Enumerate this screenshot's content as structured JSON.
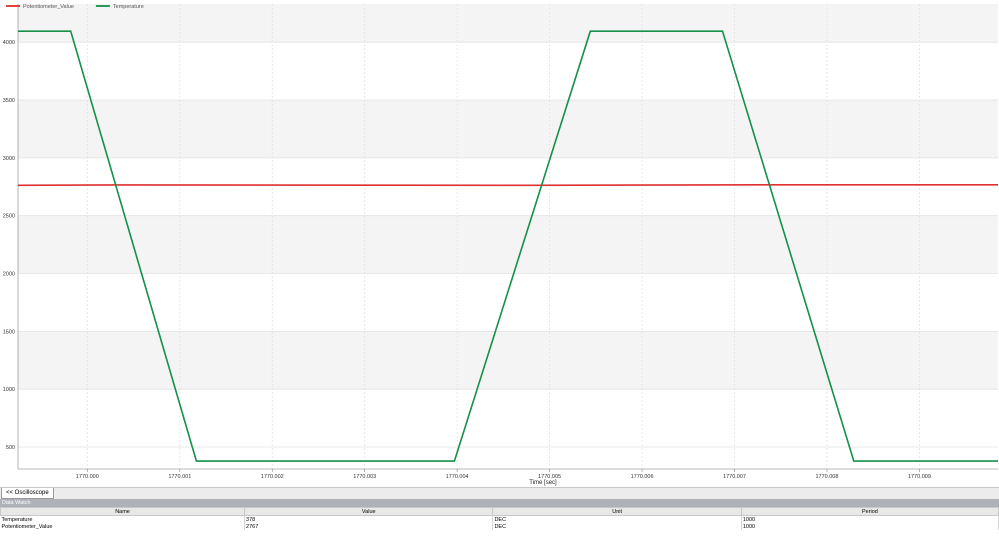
{
  "chart_data": {
    "type": "line",
    "xlabel": "Time [sec]",
    "ylabel": "",
    "xlim": [
      1769.99925,
      1770.00985
    ],
    "ylim": [
      310,
      4330
    ],
    "x_ticks": [
      "1770.000",
      "1770.001",
      "1770.002",
      "1770.003",
      "1770.004",
      "1770.005",
      "1770.006",
      "1770.007",
      "1770.008",
      "1770.009"
    ],
    "y_ticks": [
      "500",
      "1000",
      "1500",
      "2000",
      "2500",
      "3000",
      "3500",
      "4000"
    ],
    "x_tick_values": [
      1770.0,
      1770.001,
      1770.002,
      1770.003,
      1770.004,
      1770.005,
      1770.006,
      1770.007,
      1770.008,
      1770.009
    ],
    "y_tick_values": [
      500,
      1000,
      1500,
      2000,
      2500,
      3000,
      3500,
      4000
    ],
    "grid": true,
    "legend_position": "top-left",
    "series": [
      {
        "name": "Potentiometer_Value",
        "color": "#e03030",
        "x": [
          1769.99925,
          1770.0003,
          1770.0048,
          1770.0076,
          1770.00985
        ],
        "y": [
          2763,
          2766,
          2763,
          2767,
          2767
        ]
      },
      {
        "name": "Temperature",
        "color": "#14904a",
        "x": [
          1769.99925,
          1769.99982,
          1770.00118,
          1770.00397,
          1770.00544,
          1770.00687,
          1770.00829,
          1770.00985
        ],
        "y": [
          4095,
          4095,
          378,
          378,
          4095,
          4095,
          378,
          378
        ]
      }
    ]
  },
  "tab": {
    "label": "<< Oscilloscope"
  },
  "watch": {
    "title": "Data Watch",
    "columns": [
      "Name",
      "Value",
      "Unit",
      "Period"
    ],
    "rows": [
      {
        "name": "Temperature",
        "value": "378",
        "unit": "DEC",
        "period": "1000"
      },
      {
        "name": "Potentiometer_Value",
        "value": "2767",
        "unit": "DEC",
        "period": "1000"
      }
    ]
  }
}
